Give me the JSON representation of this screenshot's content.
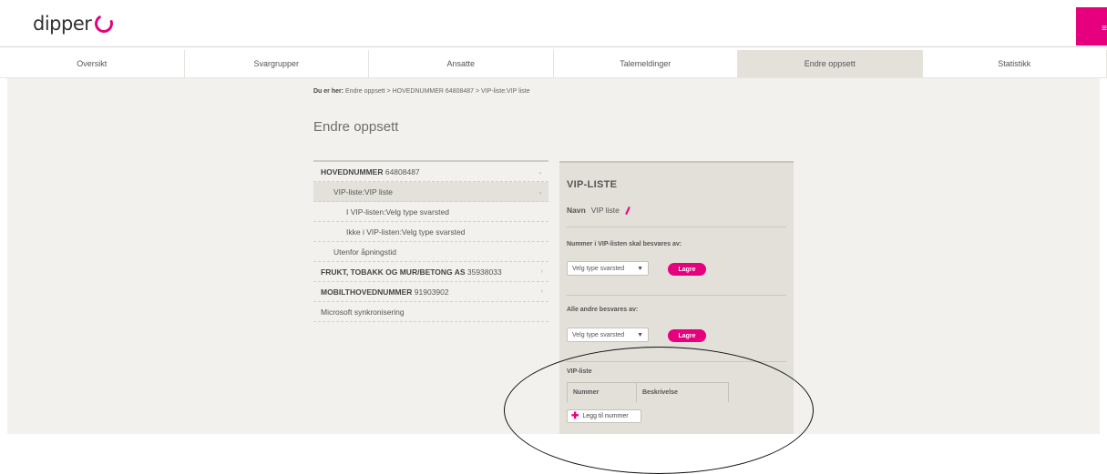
{
  "app": {
    "logo_text": "dipper"
  },
  "nav": {
    "tabs": [
      {
        "label": "Oversikt"
      },
      {
        "label": "Svargrupper"
      },
      {
        "label": "Ansatte"
      },
      {
        "label": "Talemeldinger"
      },
      {
        "label": "Endre oppsett"
      },
      {
        "label": "Statistikk"
      }
    ],
    "active": "Endre oppsett"
  },
  "breadcrumb": {
    "prefix": "Du er her:",
    "path": "Endre oppsett > HOVEDNUMMER 64808487 > VIP-liste:VIP liste"
  },
  "page_title": "Endre oppsett",
  "tree": {
    "items": [
      {
        "bold": "HOVEDNUMMER",
        "text": " 64808487",
        "level": 0,
        "chevron": "⌄"
      },
      {
        "bold": "",
        "text": "VIP-liste:VIP liste",
        "level": 1,
        "selected": true,
        "chevron": "⌄"
      },
      {
        "bold": "",
        "text": "I VIP-listen:Velg type svarsted",
        "level": 2
      },
      {
        "bold": "",
        "text": "Ikke i VIP-listen:Velg type svarsted",
        "level": 2
      },
      {
        "bold": "",
        "text": "Utenfor åpningstid",
        "level": 1
      },
      {
        "bold": "FRUKT, TOBAKK OG MUR/BETONG AS",
        "text": " 35938033",
        "level": 0,
        "chevron": "›"
      },
      {
        "bold": "MOBILTHOVEDNUMMER",
        "text": " 91903902",
        "level": 0,
        "chevron": "›"
      },
      {
        "bold": "",
        "text": "Microsoft synkronisering",
        "level": 0
      }
    ]
  },
  "panel": {
    "title": "VIP-LISTE",
    "navn_label": "Navn",
    "navn_value": "VIP liste",
    "section1_label": "Nummer i VIP-listen skal besvares av:",
    "section1_select": "Velg type svarsted",
    "section2_label": "Alle andre besvares av:",
    "section2_select": "Velg type svarsted",
    "save_label": "Lagre",
    "vip_list_label": "VIP-liste",
    "columns": [
      "Nummer",
      "Beskrivelse"
    ],
    "add_label": "Legg til nummer"
  },
  "colors": {
    "accent": "#e6007e",
    "panel_bg": "#e2e0d9",
    "main_bg": "#f2f1ed"
  }
}
